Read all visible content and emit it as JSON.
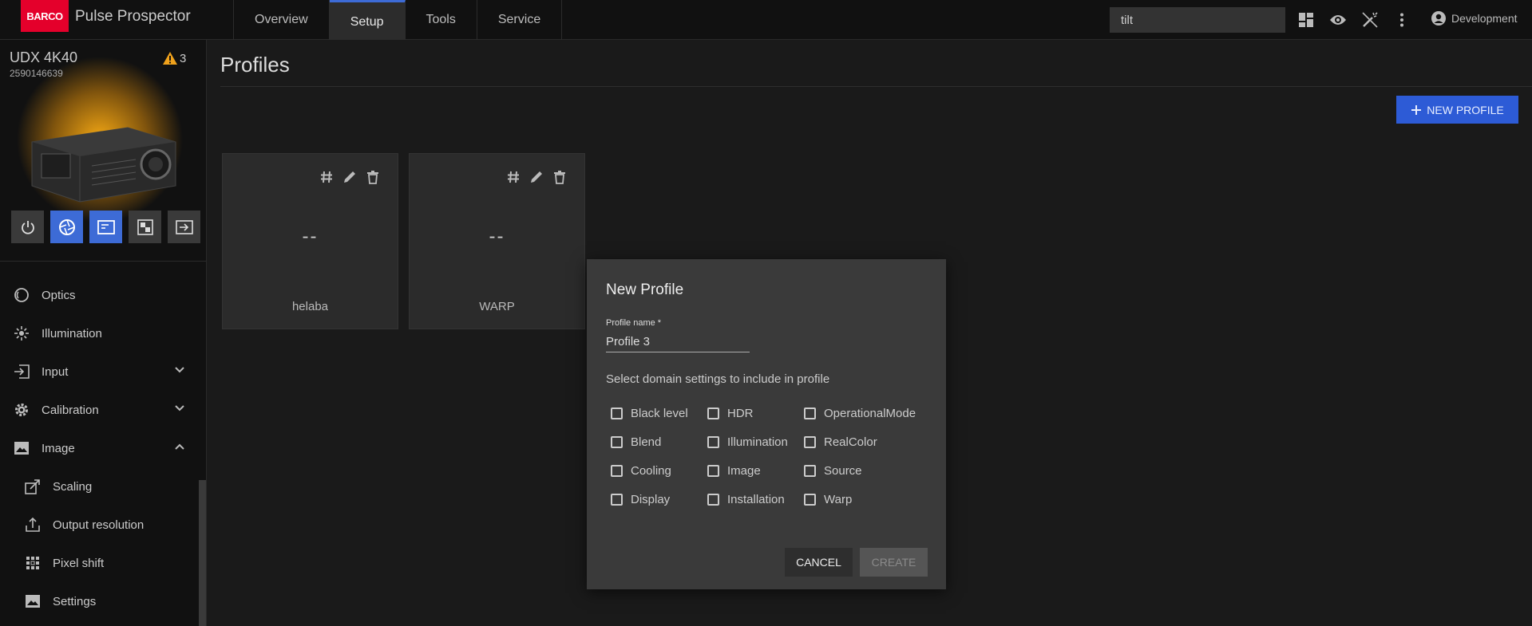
{
  "app": {
    "logo": "BARCO",
    "title": "Pulse Prospector"
  },
  "tabs": [
    {
      "label": "Overview"
    },
    {
      "label": "Setup"
    },
    {
      "label": "Tools"
    },
    {
      "label": "Service"
    }
  ],
  "search": {
    "value": "tilt"
  },
  "user": {
    "label": "Development"
  },
  "device": {
    "name": "UDX 4K40",
    "serial": "2590146639",
    "warnings": "3"
  },
  "sidebar": {
    "items": [
      {
        "label": "Optics"
      },
      {
        "label": "Illumination"
      },
      {
        "label": "Input"
      },
      {
        "label": "Calibration"
      },
      {
        "label": "Image"
      },
      {
        "label": "Scaling"
      },
      {
        "label": "Output resolution"
      },
      {
        "label": "Pixel shift"
      },
      {
        "label": "Settings"
      }
    ]
  },
  "main": {
    "title": "Profiles",
    "new_profile_label": "NEW PROFILE",
    "cards": [
      {
        "value": "--",
        "name": "helaba"
      },
      {
        "value": "--",
        "name": "WARP"
      }
    ]
  },
  "dialog": {
    "title": "New Profile",
    "field_label": "Profile name *",
    "field_value": "Profile 3",
    "hint": "Select domain settings to include in profile",
    "options": {
      "col1": [
        "Black level",
        "Blend",
        "Cooling",
        "Display"
      ],
      "col2": [
        "HDR",
        "Illumination",
        "Image",
        "Installation"
      ],
      "col3": [
        "OperationalMode",
        "RealColor",
        "Source",
        "Warp"
      ]
    },
    "cancel_label": "CANCEL",
    "create_label": "CREATE"
  },
  "colors": {
    "accent": "#3d6bd6",
    "brand": "#e4002b",
    "warning": "#f0a21c"
  }
}
